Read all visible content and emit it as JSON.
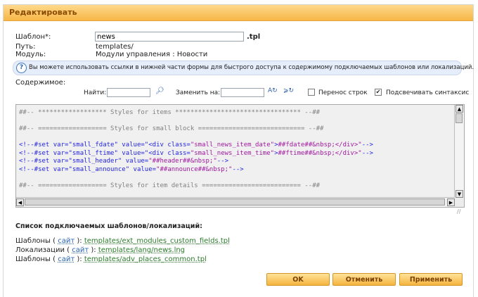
{
  "header": {
    "title": "Редактировать"
  },
  "form": {
    "template_label": "Шаблон*:",
    "template_value": "news",
    "template_ext": ".tpl",
    "path_label": "Путь:",
    "path_value": "templates/",
    "module_label": "Модуль:",
    "module_value": "Модули управления : Новости"
  },
  "info": {
    "icon": "question-icon",
    "text": "Вы можете использовать ссылки в нижней части формы для быстрого доступа к содержимому подключаемых шаблонов или локализаций."
  },
  "content": {
    "label": "Содержимое:",
    "find_label": "Найти:",
    "replace_label": "Заменить на:",
    "wrap_label": "Перенос строк",
    "wrap_checked": false,
    "highlight_label": "Подсвечивать синтаксис",
    "highlight_checked": true
  },
  "editor": {
    "line1": "##-- ****************** Styles for items ********************************* --##",
    "line2": "##-- ================== Styles for small block ============================ --##",
    "l3a": "<!--#set var=\"small_fdate\" value=\"<div class=",
    "l3b": "\"small_news_item_date\"",
    "l3c": ">",
    "l3d": "##fdate##&nbsp;</div>\"",
    "l3e": "-->",
    "l4a": "<!--#set var=\"small_ftime\" value=\"<div class=",
    "l4b": "\"small_news_item_time\"",
    "l4c": ">",
    "l4d": "##ftime##&nbsp;</div>\"",
    "l4e": "-->",
    "l5a": "<!--#set var=\"small_header\" value=",
    "l5b": "\"##header##&nbsp;\"",
    "l5c": "-->",
    "l6a": "<!--#set var=\"small_announce\" value=",
    "l6b": "\"##announce##&nbsp;\"",
    "l6c": "-->",
    "line7": "##-- ================== Styles for item details ========================== --##"
  },
  "links": {
    "title": "Список подключаемых шаблонов/локализаций:",
    "items": [
      {
        "prefix": "Шаблоны (",
        "site": "сайт",
        "suffix": "):",
        "path": "templates/ext_modules_custom_fields.tpl"
      },
      {
        "prefix": "Локализации (",
        "site": "сайт",
        "suffix": "):",
        "path": "templates/lang/news.lng"
      },
      {
        "prefix": "Шаблоны (",
        "site": "сайт",
        "suffix": "):",
        "path": "templates/adv_places_common.tpl"
      }
    ]
  },
  "buttons": {
    "ok": "OK",
    "cancel": "Отменить",
    "apply": "Применить"
  },
  "colors": {
    "header_bg": "#f7b647",
    "button_bg": "#f5b43e",
    "link": "#2c7a2c",
    "info_bg": "#e6eefb"
  }
}
